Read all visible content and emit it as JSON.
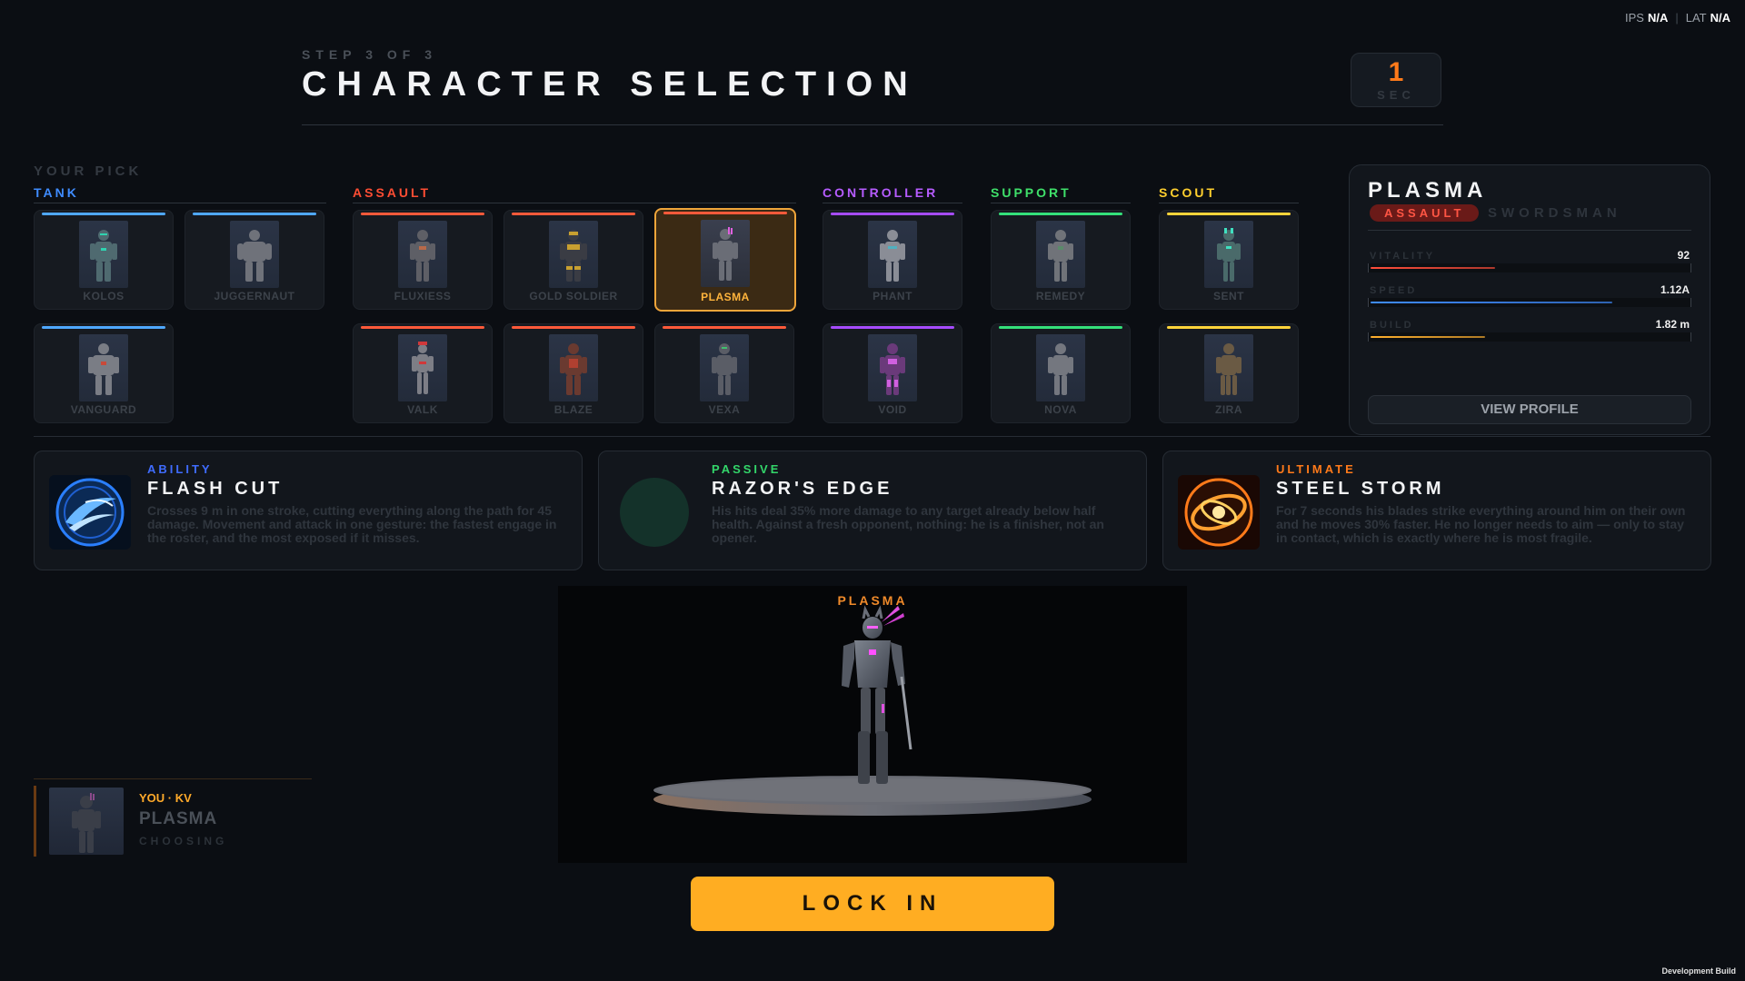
{
  "netstats": {
    "ips_label": "IPS",
    "ips_value": "N/A",
    "lat_label": "LAT",
    "lat_value": "N/A",
    "separator": "|"
  },
  "header": {
    "step": "STEP 3 OF 3",
    "title": "CHARACTER SELECTION"
  },
  "timer": {
    "value": "1",
    "unit": "SEC"
  },
  "your_pick_label": "YOUR PICK",
  "categories": {
    "tank": {
      "label": "TANK",
      "color": "#3f8cff"
    },
    "assault": {
      "label": "ASSAULT",
      "color": "#ff4d33"
    },
    "controller": {
      "label": "CONTROLLER",
      "color": "#b65cff"
    },
    "support": {
      "label": "SUPPORT",
      "color": "#3fe06a"
    },
    "scout": {
      "label": "SCOUT",
      "color": "#ffcf2e"
    }
  },
  "bar_colors": {
    "tank": "#4fa8ff",
    "assault": "#ff5a3a",
    "controller": "#a64cff",
    "support": "#34e07a",
    "scout": "#ffd43a"
  },
  "characters": {
    "kolos": "KOLOS",
    "juggernaut": "JUGGERNAUT",
    "vanguard": "VANGUARD",
    "fluxiess": "FLUXIESS",
    "gold_soldier": "GOLD SOLDIER",
    "plasma": "PLASMA",
    "valk": "VALK",
    "blaze": "BLAZE",
    "vexa": "VEXA",
    "phant": "PHANT",
    "void": "VOID",
    "remedy": "REMEDY",
    "nova": "NOVA",
    "sent": "SENT",
    "zira": "ZIRA"
  },
  "detail": {
    "name": "PLASMA",
    "role": "ASSAULT",
    "archetype": "SWORDSMAN",
    "stats": [
      {
        "label": "VITALITY",
        "value": "92",
        "fraction": 0.39,
        "color": "#ff4d3a"
      },
      {
        "label": "SPEED",
        "value": "1.12A",
        "fraction": 0.76,
        "color": "#3f8cff"
      },
      {
        "label": "BUILD",
        "value": "1.82 m",
        "fraction": 0.36,
        "color": "#ffb02e"
      }
    ],
    "view_profile": "VIEW PROFILE"
  },
  "abilities": [
    {
      "type": "ABILITY",
      "type_color": "#3f6cff",
      "name": "FLASH CUT",
      "desc": "Crosses 9 m in one stroke, cutting everything along the path for 45 damage. Movement and attack in one gesture: the fastest engage in the roster, and the most exposed if it misses.",
      "icon": "blue-slash-icon"
    },
    {
      "type": "PASSIVE",
      "type_color": "#33d66a",
      "name": "RAZOR'S EDGE",
      "desc": "His hits deal 35% more damage to any target already below half health. Against a fresh opponent, nothing: he is a finisher, not an opener.",
      "icon": "passive-orb-icon"
    },
    {
      "type": "ULTIMATE",
      "type_color": "#ff7a1a",
      "name": "STEEL STORM",
      "desc": "For 7 seconds his blades strike everything around him on their own and he moves 30% faster. He no longer needs to aim — only to stay in contact, which is exactly where he is most fragile.",
      "icon": "fire-vortex-icon"
    }
  ],
  "player_slot": {
    "who": "YOU · KV",
    "pick": "PLASMA",
    "state": "CHOOSING"
  },
  "viewer": {
    "name": "PLASMA"
  },
  "lock_in": "LOCK IN",
  "dev_build": "Development Build"
}
